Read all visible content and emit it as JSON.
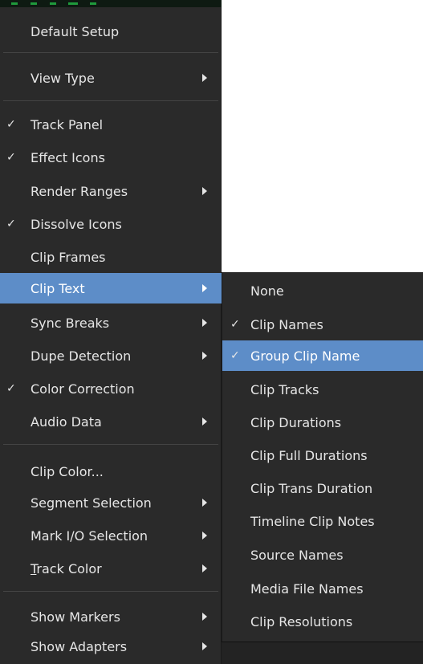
{
  "menu": {
    "items": [
      {
        "label": "Default Setup",
        "checked": false,
        "submenu": false
      },
      {
        "label": "View Type",
        "checked": false,
        "submenu": true
      },
      {
        "label": "Track Panel",
        "checked": true,
        "submenu": false
      },
      {
        "label": "Effect Icons",
        "checked": true,
        "submenu": false
      },
      {
        "label": "Render Ranges",
        "checked": false,
        "submenu": true
      },
      {
        "label": "Dissolve Icons",
        "checked": true,
        "submenu": false
      },
      {
        "label": "Clip Frames",
        "checked": false,
        "submenu": false
      },
      {
        "label": "Clip Text",
        "checked": false,
        "submenu": true,
        "highlighted": true
      },
      {
        "label": "Sync Breaks",
        "checked": false,
        "submenu": true
      },
      {
        "label": "Dupe Detection",
        "checked": false,
        "submenu": true
      },
      {
        "label": "Color Correction",
        "checked": true,
        "submenu": false
      },
      {
        "label": "Audio Data",
        "checked": false,
        "submenu": true
      },
      {
        "label": "Clip Color...",
        "checked": false,
        "submenu": false
      },
      {
        "label": "Segment Selection",
        "checked": false,
        "submenu": true
      },
      {
        "label": "Mark I/O Selection",
        "checked": false,
        "submenu": true
      },
      {
        "label_prefix": "T",
        "label_rest": "rack Color",
        "checked": false,
        "submenu": true
      },
      {
        "label": "Show Markers",
        "checked": false,
        "submenu": true
      },
      {
        "label": "Show Adapters",
        "checked": false,
        "submenu": true
      }
    ],
    "check_glyph": "✓"
  },
  "submenu": {
    "items": [
      {
        "label": "None",
        "checked": false
      },
      {
        "label": "Clip Names",
        "checked": true
      },
      {
        "label": "Group Clip Name",
        "checked": true,
        "highlighted": true
      },
      {
        "label": "Clip Tracks",
        "checked": false
      },
      {
        "label": "Clip Durations",
        "checked": false
      },
      {
        "label": "Clip Full Durations",
        "checked": false
      },
      {
        "label": "Clip Trans Duration",
        "checked": false
      },
      {
        "label": "Timeline Clip Notes",
        "checked": false
      },
      {
        "label": "Source Names",
        "checked": false
      },
      {
        "label": "Media File Names",
        "checked": false
      },
      {
        "label": "Clip Resolutions",
        "checked": false
      }
    ]
  },
  "colors": {
    "menu_bg": "#2a2a2a",
    "highlight": "#5d8dc8",
    "text": "#e6e6e6"
  }
}
